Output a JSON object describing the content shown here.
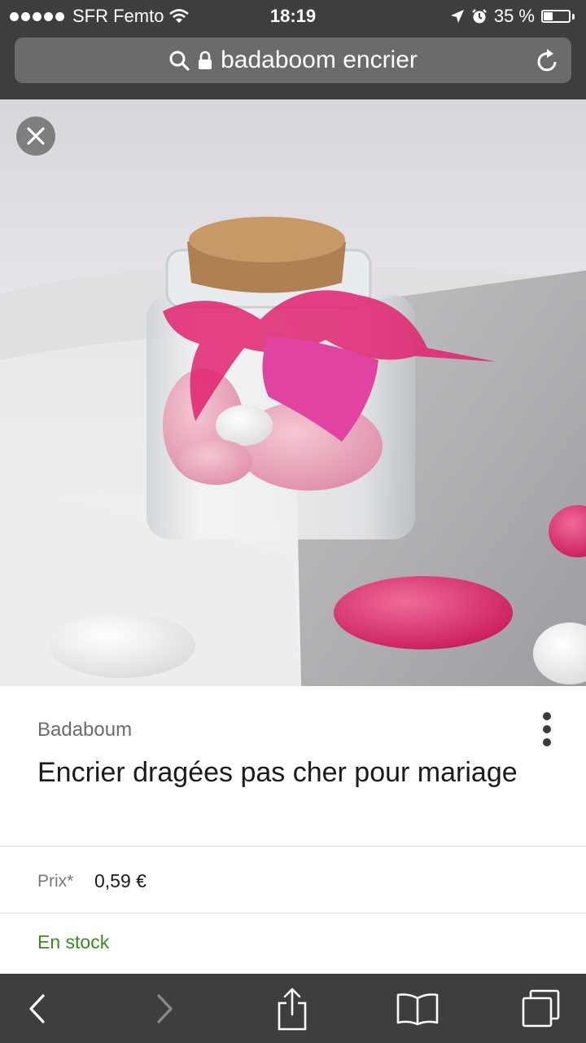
{
  "status": {
    "carrier": "SFR Femto",
    "time": "18:19",
    "battery_text": "35 %",
    "battery_level": 0.35
  },
  "browser": {
    "url_text": "badaboom encrier"
  },
  "product": {
    "brand": "Badaboum",
    "title": "Encrier dragées pas cher pour mariage",
    "price_label": "Prix*",
    "price_value": "0,59 €",
    "stock": "En stock"
  },
  "colors": {
    "chrome": "#3e3e3e",
    "urlbar": "#6b6b6b",
    "stock_green": "#3a8a1e",
    "ribbon_pink": "#e0226f"
  },
  "icons": [
    "search-icon",
    "lock-icon",
    "reload-icon",
    "close-icon",
    "more-vert-icon",
    "back-icon",
    "forward-icon",
    "share-icon",
    "bookmarks-icon",
    "tabs-icon"
  ]
}
